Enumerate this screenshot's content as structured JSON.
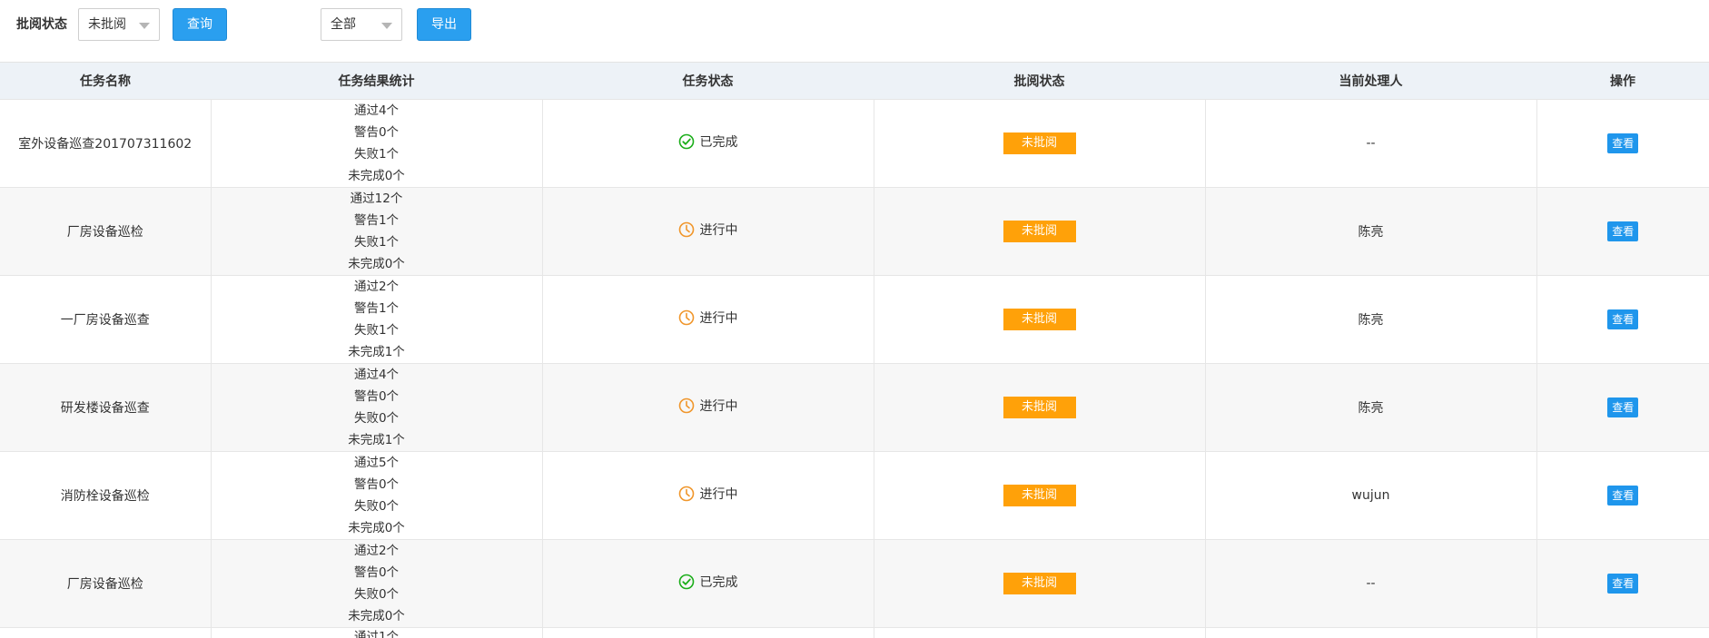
{
  "filters": {
    "review_status_label": "批阅状态",
    "review_status_value": "未批阅",
    "query_button": "查询",
    "scope_value": "全部",
    "export_button": "导出"
  },
  "table": {
    "columns": [
      "任务名称",
      "任务结果统计",
      "任务状态",
      "批阅状态",
      "当前处理人",
      "操作"
    ],
    "rows": [
      {
        "name": "室外设备巡查201707311602",
        "stats": [
          "通过4个",
          "警告0个",
          "失败1个",
          "未完成0个"
        ],
        "task_status": "已完成",
        "status_icon": "check-circle-icon",
        "review": "未批阅",
        "handler": "--",
        "action": "查看"
      },
      {
        "name": "厂房设备巡检",
        "stats": [
          "通过12个",
          "警告1个",
          "失败1个",
          "未完成0个"
        ],
        "task_status": "进行中",
        "status_icon": "clock-icon",
        "review": "未批阅",
        "handler": "陈亮",
        "action": "查看"
      },
      {
        "name": "一厂房设备巡查",
        "stats": [
          "通过2个",
          "警告1个",
          "失败1个",
          "未完成1个"
        ],
        "task_status": "进行中",
        "status_icon": "clock-icon",
        "review": "未批阅",
        "handler": "陈亮",
        "action": "查看"
      },
      {
        "name": "研发楼设备巡查",
        "stats": [
          "通过4个",
          "警告0个",
          "失败0个",
          "未完成1个"
        ],
        "task_status": "进行中",
        "status_icon": "clock-icon",
        "review": "未批阅",
        "handler": "陈亮",
        "action": "查看"
      },
      {
        "name": "消防栓设备巡检",
        "stats": [
          "通过5个",
          "警告0个",
          "失败0个",
          "未完成0个"
        ],
        "task_status": "进行中",
        "status_icon": "clock-icon",
        "review": "未批阅",
        "handler": "wujun",
        "action": "查看"
      },
      {
        "name": "厂房设备巡检",
        "stats": [
          "通过2个",
          "警告0个",
          "失败0个",
          "未完成0个"
        ],
        "task_status": "已完成",
        "status_icon": "check-circle-icon",
        "review": "未批阅",
        "handler": "--",
        "action": "查看"
      }
    ],
    "partial_row_first_stat": "通过1个"
  },
  "colors": {
    "primary": "#2a9fef",
    "badge": "#ffa109",
    "done_green": "#1aad19",
    "progress_orange": "#f0962b",
    "header_bg": "#edf2f7"
  }
}
